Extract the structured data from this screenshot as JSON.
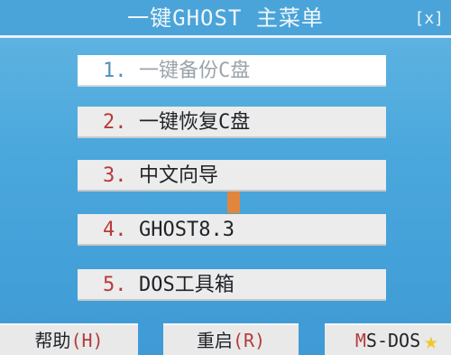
{
  "header": {
    "title": "一键GHOST 主菜单",
    "close_label": "[x]"
  },
  "menu": {
    "selected_index": 0,
    "items": [
      {
        "number": "1.",
        "label": "一键备份C盘"
      },
      {
        "number": "2.",
        "label": "一键恢复C盘"
      },
      {
        "number": "3.",
        "label": "中文向导"
      },
      {
        "number": "4.",
        "label": "GHOST8.3"
      },
      {
        "number": "5.",
        "label": "DOS工具箱"
      }
    ]
  },
  "footer": {
    "help": {
      "text": "帮助",
      "hotkey": "(H)"
    },
    "restart": {
      "text": "重启",
      "hotkey": "(R)"
    },
    "msdos": {
      "prefix": "M",
      "text": "S-DOS"
    }
  },
  "colors": {
    "background": "#4aa7dc",
    "menu_item": "#ececec",
    "selected_item": "#ffffff",
    "hotkey": "#b73a3a",
    "cursor": "#e0863d"
  }
}
